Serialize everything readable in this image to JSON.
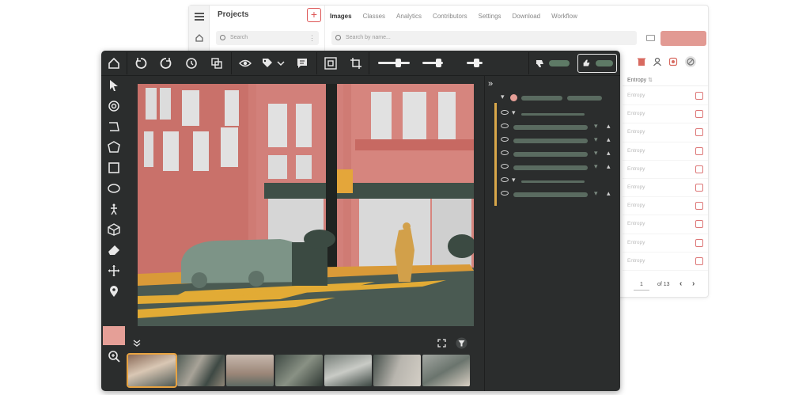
{
  "back_window": {
    "projects_title": "Projects",
    "add_button": "+",
    "projects_search_placeholder": "Search",
    "tabs": [
      {
        "label": "Images",
        "active": true
      },
      {
        "label": "Classes",
        "active": false
      },
      {
        "label": "Analytics",
        "active": false
      },
      {
        "label": "Contributors",
        "active": false
      },
      {
        "label": "Settings",
        "active": false
      },
      {
        "label": "Download",
        "active": false
      },
      {
        "label": "Workflow",
        "active": false
      }
    ],
    "image_search_placeholder": "Search by name...",
    "entropy_header": "Entropy",
    "rows": [
      "Entropy",
      "Entropy",
      "Entropy",
      "Entropy",
      "Entropy",
      "Entropy",
      "Entropy",
      "Entropy",
      "Entropy",
      "Entropy"
    ],
    "pager": {
      "page": "1",
      "of": "of 13",
      "prev": "‹",
      "next": "›"
    }
  },
  "editor": {
    "accent_color": "#e59f97",
    "highlight_color": "#e8a341"
  }
}
